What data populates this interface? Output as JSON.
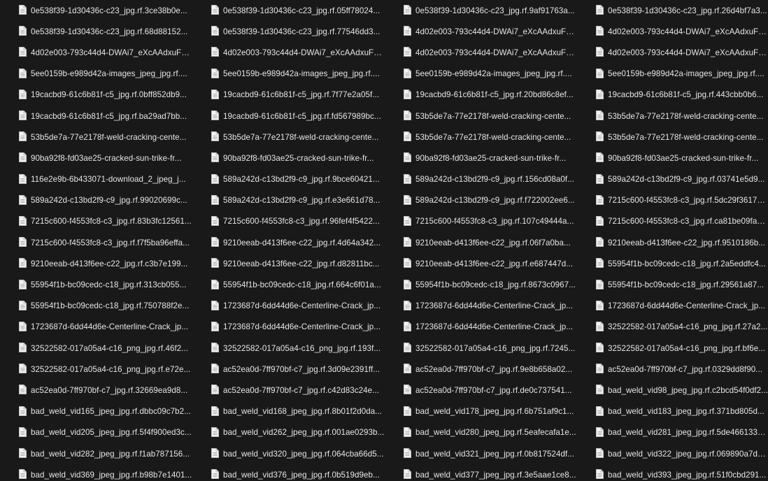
{
  "files": [
    "0e538f39-1d30436c-c23_jpg.rf.3ce38b0e...",
    "0e538f39-1d30436c-c23_jpg.rf.05ff78024...",
    "0e538f39-1d30436c-c23_jpg.rf.9af91763a...",
    "0e538f39-1d30436c-c23_jpg.rf.26d4bf7a3...",
    "0e538f39-1d30436c-c23_jpg.rf.68d88152...",
    "0e538f39-1d30436c-c23_jpg.rf.77546dd3...",
    "4d02e003-793c44d4-DWAi7_eXcAAdxuF_j...",
    "4d02e003-793c44d4-DWAi7_eXcAAdxuF_j...",
    "4d02e003-793c44d4-DWAi7_eXcAAdxuF_j...",
    "4d02e003-793c44d4-DWAi7_eXcAAdxuF_j...",
    "4d02e003-793c44d4-DWAi7_eXcAAdxuF_j...",
    "4d02e003-793c44d4-DWAi7_eXcAAdxuF_j...",
    "5ee0159b-e989d42a-images_jpeg_jpg.rf....",
    "5ee0159b-e989d42a-images_jpeg_jpg.rf....",
    "5ee0159b-e989d42a-images_jpeg_jpg.rf....",
    "5ee0159b-e989d42a-images_jpeg_jpg.rf....",
    "19cacbd9-61c6b81f-c5_jpg.rf.0bff852db9...",
    "19cacbd9-61c6b81f-c5_jpg.rf.7f77e2a05f...",
    "19cacbd9-61c6b81f-c5_jpg.rf.20bd86c8ef...",
    "19cacbd9-61c6b81f-c5_jpg.rf.443cbb0b6...",
    "19cacbd9-61c6b81f-c5_jpg.rf.ba29ad7bb...",
    "19cacbd9-61c6b81f-c5_jpg.rf.fd567989bc...",
    "53b5de7a-77e2178f-weld-cracking-cente...",
    "53b5de7a-77e2178f-weld-cracking-cente...",
    "53b5de7a-77e2178f-weld-cracking-cente...",
    "53b5de7a-77e2178f-weld-cracking-cente...",
    "53b5de7a-77e2178f-weld-cracking-cente...",
    "53b5de7a-77e2178f-weld-cracking-cente...",
    "90ba92f8-fd03ae25-cracked-sun-trike-fr...",
    "90ba92f8-fd03ae25-cracked-sun-trike-fr...",
    "90ba92f8-fd03ae25-cracked-sun-trike-fr...",
    "90ba92f8-fd03ae25-cracked-sun-trike-fr...",
    "116e2e9b-6b433071-download_2_jpeg_j...",
    "589a242d-c13bd2f9-c9_jpg.rf.9bce60421...",
    "589a242d-c13bd2f9-c9_jpg.rf.156cd08a0f...",
    "589a242d-c13bd2f9-c9_jpg.rf.03741e5d9...",
    "589a242d-c13bd2f9-c9_jpg.rf.99020699c...",
    "589a242d-c13bd2f9-c9_jpg.rf.e3e661d78...",
    "589a242d-c13bd2f9-c9_jpg.rf.f722002ee6...",
    "7215c600-f4553fc8-c3_jpg.rf.5dc29f36172...",
    "7215c600-f4553fc8-c3_jpg.rf.83b3fc12561...",
    "7215c600-f4553fc8-c3_jpg.rf.96fef4f5422...",
    "7215c600-f4553fc8-c3_jpg.rf.107c49444a...",
    "7215c600-f4553fc8-c3_jpg.rf.ca81be09fa5...",
    "7215c600-f4553fc8-c3_jpg.rf.f7f5ba96effa...",
    "9210eeab-d413f6ee-c22_jpg.rf.4d64a342...",
    "9210eeab-d413f6ee-c22_jpg.rf.06f7a0ba...",
    "9210eeab-d413f6ee-c22_jpg.rf.9510186b...",
    "9210eeab-d413f6ee-c22_jpg.rf.c3b7e199...",
    "9210eeab-d413f6ee-c22_jpg.rf.d82811bc...",
    "9210eeab-d413f6ee-c22_jpg.rf.e687447d...",
    "55954f1b-bc09cedc-c18_jpg.rf.2a5eddfc4...",
    "55954f1b-bc09cedc-c18_jpg.rf.313cb055...",
    "55954f1b-bc09cedc-c18_jpg.rf.664c6f01a...",
    "55954f1b-bc09cedc-c18_jpg.rf.8673c0967...",
    "55954f1b-bc09cedc-c18_jpg.rf.29561a87...",
    "55954f1b-bc09cedc-c18_jpg.rf.750788f2e...",
    "1723687d-6dd44d6e-Centerline-Crack_jp...",
    "1723687d-6dd44d6e-Centerline-Crack_jp...",
    "1723687d-6dd44d6e-Centerline-Crack_jp...",
    "1723687d-6dd44d6e-Centerline-Crack_jp...",
    "1723687d-6dd44d6e-Centerline-Crack_jp...",
    "1723687d-6dd44d6e-Centerline-Crack_jp...",
    "32522582-017a05a4-c16_png_jpg.rf.27a2...",
    "32522582-017a05a4-c16_png_jpg.rf.46f2...",
    "32522582-017a05a4-c16_png_jpg.rf.193f...",
    "32522582-017a05a4-c16_png_jpg.rf.7245...",
    "32522582-017a05a4-c16_png_jpg.rf.bf6e...",
    "32522582-017a05a4-c16_png_jpg.rf.e72e...",
    "ac52ea0d-7ff970bf-c7_jpg.rf.3d09e2391ff...",
    "ac52ea0d-7ff970bf-c7_jpg.rf.9e8b658a02...",
    "ac52ea0d-7ff970bf-c7_jpg.rf.0329dd8f90...",
    "ac52ea0d-7ff970bf-c7_jpg.rf.32669ea9d8...",
    "ac52ea0d-7ff970bf-c7_jpg.rf.c42d83c24e...",
    "ac52ea0d-7ff970bf-c7_jpg.rf.de0c737541...",
    "bad_weld_vid98_jpeg_jpg.rf.c2bcd54f0df2...",
    "bad_weld_vid165_jpeg_jpg.rf.dbbc09c7b2...",
    "bad_weld_vid168_jpeg_jpg.rf.8b01f2d0da...",
    "bad_weld_vid178_jpeg_jpg.rf.6b751af9c1...",
    "bad_weld_vid183_jpeg_jpg.rf.371bd805d...",
    "bad_weld_vid205_jpeg_jpg.rf.5f4f900ed3c...",
    "bad_weld_vid262_jpeg_jpg.rf.001ae0293b...",
    "bad_weld_vid280_jpeg_jpg.rf.5eafecafa1e...",
    "bad_weld_vid281_jpeg_jpg.rf.5de4661335...",
    "bad_weld_vid282_jpeg_jpg.rf.f1ab787156...",
    "bad_weld_vid320_jpeg_jpg.rf.064cba66d5...",
    "bad_weld_vid321_jpeg_jpg.rf.0b817524df...",
    "bad_weld_vid322_jpeg_jpg.rf.069890a7d7...",
    "bad_weld_vid369_jpeg_jpg.rf.b98b7e1401...",
    "bad_weld_vid376_jpeg_jpg.rf.0b519d9eb...",
    "bad_weld_vid377_jpeg_jpg.rf.3e5aae1ce8...",
    "bad_weld_vid393_jpeg_jpg.rf.51f0cbd291..."
  ],
  "icon": "document-file-icon",
  "colors": {
    "background": "#191919",
    "text": "#e6e6e6",
    "icon_fill": "#f2f2f2",
    "icon_fold": "#bdbdbd"
  }
}
